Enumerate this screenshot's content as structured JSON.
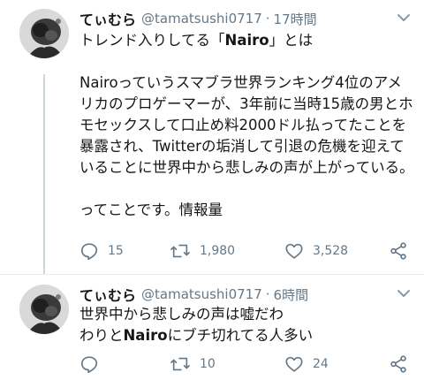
{
  "colors": {
    "text": "#14171a",
    "secondary": "#657786",
    "thread_line": "#ccd6dd",
    "divider": "#e6ecf0"
  },
  "tweets": [
    {
      "display_name": "てぃむら",
      "handle": "@tamatsushi0717",
      "separator": "·",
      "time": "17時間",
      "text_part1": "トレンド入りしてる「",
      "text_bold": "Nairo",
      "text_part2": "」とは\n\nNairoっていうスマブラ世界ランキング4位のアメリカのプロゲーマーが、3年前に当時15歳の男とホモセックスして口止め料2000ドル払ってたことを暴露され、Twitterの垢消して引退の危機を迎えていることに世界中から悲しみの声が上がっている。\n\nってことです。情報量",
      "replies": "15",
      "retweets": "1,980",
      "likes": "3,528",
      "icons": [
        "reply-icon",
        "retweet-icon",
        "like-icon",
        "share-icon"
      ]
    },
    {
      "display_name": "てぃむら",
      "handle": "@tamatsushi0717",
      "separator": "·",
      "time": "6時間",
      "text_part1": "世界中から悲しみの声は嘘だわ\nわりと",
      "text_bold": "Nairo",
      "text_part2": "にブチ切れてる人多い",
      "replies": "",
      "retweets": "10",
      "likes": "24",
      "icons": [
        "reply-icon",
        "retweet-icon",
        "like-icon",
        "share-icon"
      ]
    }
  ]
}
